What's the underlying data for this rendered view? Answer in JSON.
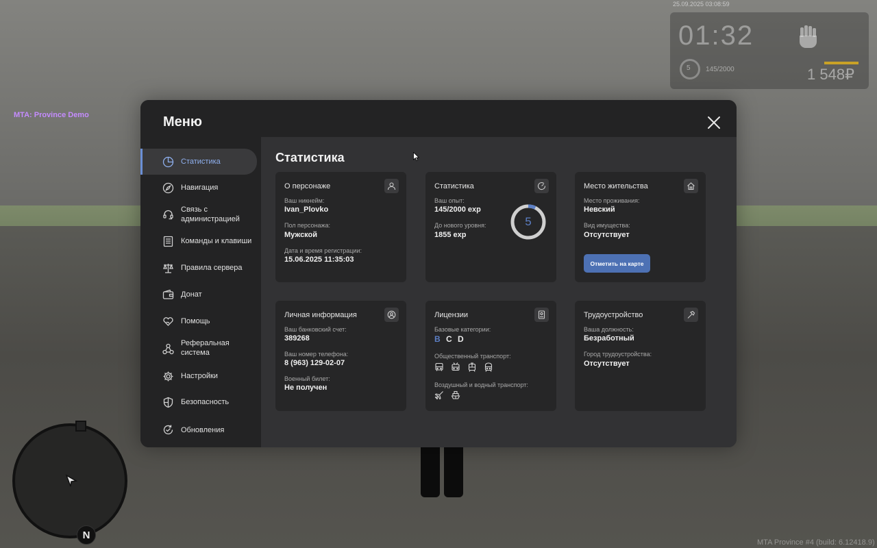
{
  "hud": {
    "timestamp": "25.09.2025 03:08:59",
    "clock": "01:32",
    "level": "5",
    "exp": "145/2000",
    "money": "1 548₽",
    "server_tag": "MTA: Province Demo",
    "build": "MTA Province #4 (build: 6.12418.9)",
    "compass_north": "N"
  },
  "menu": {
    "title": "Меню",
    "sidebar": [
      {
        "label": "Статистика",
        "icon": "pie-chart-icon",
        "active": true
      },
      {
        "label": "Навигация",
        "icon": "compass-icon"
      },
      {
        "label": "Связь с администрацией",
        "icon": "headset-icon"
      },
      {
        "label": "Команды и клавиши",
        "icon": "keyboard-list-icon"
      },
      {
        "label": "Правила сервера",
        "icon": "scales-icon"
      },
      {
        "label": "Донат",
        "icon": "wallet-icon"
      },
      {
        "label": "Помощь",
        "icon": "heart-hand-icon"
      },
      {
        "label": "Реферальная система",
        "icon": "network-icon"
      },
      {
        "label": "Настройки",
        "icon": "gear-icon"
      },
      {
        "label": "Безопасность",
        "icon": "shield-icon"
      },
      {
        "label": "Обновления",
        "icon": "refresh-check-icon"
      }
    ],
    "content_title": "Статистика",
    "cards": {
      "character": {
        "title": "О персонаже",
        "nick_label": "Ваш никнейм:",
        "nick": "Ivan_Plovko",
        "gender_label": "Пол персонажа:",
        "gender": "Мужской",
        "reg_label": "Дата и время регистрации:",
        "reg": "15.06.2025 11:35:03"
      },
      "stats": {
        "title": "Статистика",
        "exp_label": "Ваш опыт:",
        "exp": "145/2000 exp",
        "next_label": "До нового уровня:",
        "next": "1855 exp",
        "level": "5",
        "progress": 0.0725
      },
      "residence": {
        "title": "Место жительства",
        "place_label": "Место проживания:",
        "place": "Невский",
        "property_label": "Вид имущества:",
        "property": "Отсутствует",
        "map_button": "Отметить на карте"
      },
      "personal": {
        "title": "Личная информация",
        "bank_label": "Ваш банковский счет:",
        "bank": "389268",
        "phone_label": "Ваш номер телефона:",
        "phone": "8 (963) 129-02-07",
        "military_label": "Военный билет:",
        "military": "Не получен"
      },
      "licenses": {
        "title": "Лицензии",
        "base_label": "Базовые категории:",
        "categories": [
          {
            "name": "B",
            "owned": true
          },
          {
            "name": "C",
            "owned": false
          },
          {
            "name": "D",
            "owned": false
          }
        ],
        "public_label": "Общественный транспорт:",
        "public_icons": [
          "bus-icon",
          "trolleybus-icon",
          "tram-icon",
          "metro-icon"
        ],
        "air_label": "Воздушный и водный транспорт:",
        "air_icons": [
          "plane-icon",
          "boat-icon"
        ]
      },
      "employment": {
        "title": "Трудоустройство",
        "position_label": "Ваша должность:",
        "position": "Безработный",
        "city_label": "Город трудоустройства:",
        "city": "Отсутствует"
      }
    }
  }
}
